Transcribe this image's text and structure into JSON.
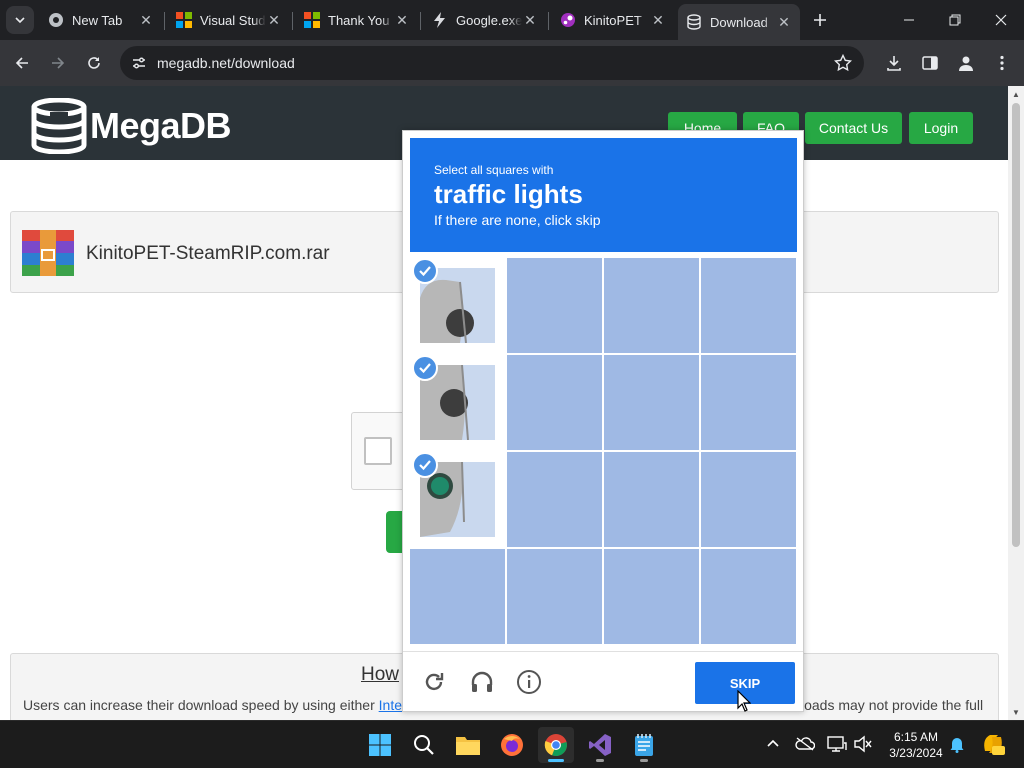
{
  "browser": {
    "tabs": [
      {
        "title": "New Tab",
        "icon": "chrome-icon",
        "active": false
      },
      {
        "title": "Visual Studio",
        "icon": "microsoft-icon",
        "active": false
      },
      {
        "title": "Thank You",
        "icon": "microsoft-icon",
        "active": false
      },
      {
        "title": "Google.exe",
        "icon": "bolt-icon",
        "active": false
      },
      {
        "title": "KinitoPET",
        "icon": "steam-icon",
        "active": false
      },
      {
        "title": "Download",
        "icon": "database-icon",
        "active": true
      }
    ],
    "url": "megadb.net/download"
  },
  "site": {
    "logo_text": "MegaDB",
    "nav": [
      "Home",
      "FAQ",
      "Contact Us",
      "Login"
    ],
    "file_name": "KinitoPET-SteamRIP.com.rar",
    "howto_title": "How",
    "howto_text_left": "Users can increase their download speed by using either ",
    "howto_link": "Intern",
    "howto_text_right": "loads may not provide the full"
  },
  "captcha": {
    "instruction": "Select all squares with",
    "target": "traffic lights",
    "subtitle": "If there are none, click skip",
    "skip_label": "SKIP",
    "selected_cells": [
      0,
      4,
      8
    ]
  },
  "taskbar": {
    "time": "6:15 AM",
    "date": "3/23/2024"
  },
  "colors": {
    "accent_blue": "#1a73e8",
    "site_green": "#27a844",
    "header_dark": "#2b3338"
  }
}
